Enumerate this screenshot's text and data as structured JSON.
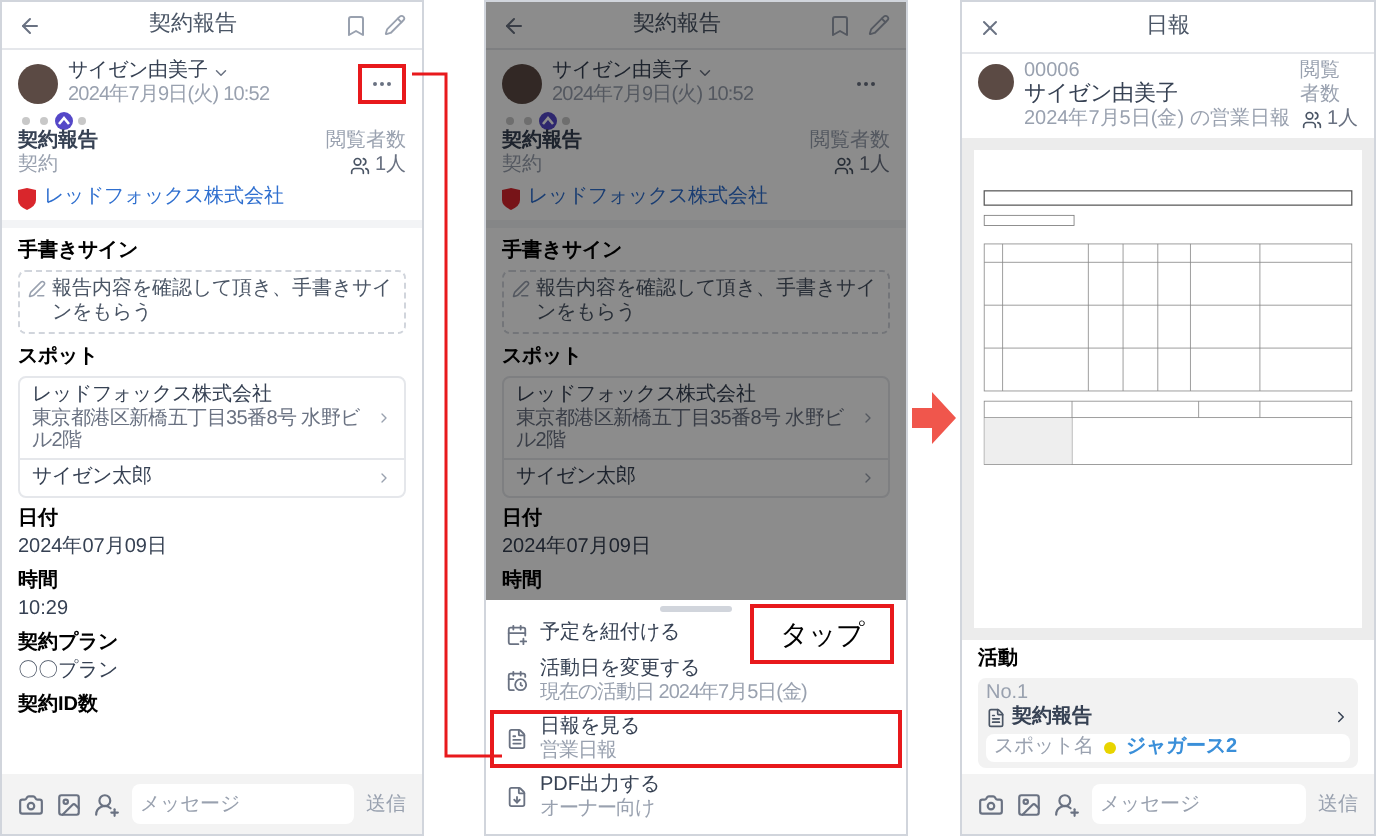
{
  "screens": [
    {
      "kind": "report",
      "dimmed": false,
      "header": {
        "title": "契約報告"
      },
      "author": {
        "name": "サイゼン由美子",
        "date": "2024年7月9日(火) 10:52"
      },
      "more_button": {
        "highlighted": true
      },
      "report": {
        "title": "契約報告",
        "type": "契約",
        "viewers_label": "閲覧者数",
        "viewers": "1人",
        "company": "レッドフォックス株式会社"
      },
      "sections": [
        {
          "kind": "signature",
          "label": "手書きサイン",
          "text": "報告内容を確認して頂き、手書きサインをもらう"
        },
        {
          "kind": "spot",
          "label": "スポット",
          "items": [
            {
              "name": "レッドフォックス株式会社",
              "address": "東京都港区新橋五丁目35番8号 水野ビル2階"
            },
            {
              "name": "サイゼン太郎"
            }
          ]
        },
        {
          "kind": "field",
          "label": "日付",
          "value": "2024年07月09日"
        },
        {
          "kind": "field",
          "label": "時間",
          "value": "10:29"
        },
        {
          "kind": "field",
          "label": "契約プラン",
          "value": "〇〇プラン"
        },
        {
          "kind": "field",
          "label": "契約ID数"
        }
      ],
      "composer": {
        "placeholder": "メッセージ",
        "send": "送信"
      }
    },
    {
      "kind": "report",
      "dimmed": true,
      "header": {
        "title": "契約報告"
      },
      "author": {
        "name": "サイゼン由美子",
        "date": "2024年7月9日(火) 10:52"
      },
      "more_button": {
        "highlighted": false
      },
      "report": {
        "title": "契約報告",
        "type": "契約",
        "viewers_label": "閲覧者数",
        "viewers": "1人",
        "company": "レッドフォックス株式会社"
      },
      "sections": [
        {
          "kind": "signature",
          "label": "手書きサイン",
          "text": "報告内容を確認して頂き、手書きサインをもらう"
        },
        {
          "kind": "spot",
          "label": "スポット",
          "items": [
            {
              "name": "レッドフォックス株式会社",
              "address": "東京都港区新橋五丁目35番8号 水野ビル2階"
            },
            {
              "name": "サイゼン太郎"
            }
          ]
        },
        {
          "kind": "field",
          "label": "日付",
          "value": "2024年07月09日"
        },
        {
          "kind": "field",
          "label": "時間"
        }
      ],
      "sheet": {
        "items": [
          {
            "kind": "link",
            "title": "予定を紐付ける",
            "highlighted": false
          },
          {
            "kind": "date",
            "title": "活動日を変更する",
            "subtitle": "現在の活動日 2024年7月5日(金)",
            "highlighted": false
          },
          {
            "kind": "report",
            "title": "日報を見る",
            "subtitle": "営業日報",
            "highlighted": true
          },
          {
            "kind": "pdf",
            "title": "PDF出力する",
            "subtitle": "オーナー向け",
            "highlighted": false
          }
        ]
      },
      "callout": {
        "text": "タップ"
      }
    },
    {
      "kind": "daily",
      "header": {
        "title": "日報"
      },
      "author": {
        "code": "00006",
        "name": "サイゼン由美子",
        "caption": "2024年7月5日(金) の営業日報",
        "viewers_label": "閲覧者数",
        "viewers": "1人"
      },
      "activity": {
        "label": "活動",
        "items": [
          {
            "number": "No.1",
            "title": "契約報告",
            "spot_label": "スポット名",
            "spot": "ジャガース2",
            "color": "#e8d400"
          }
        ]
      },
      "composer": {
        "placeholder": "メッセージ",
        "send": "送信"
      }
    }
  ]
}
